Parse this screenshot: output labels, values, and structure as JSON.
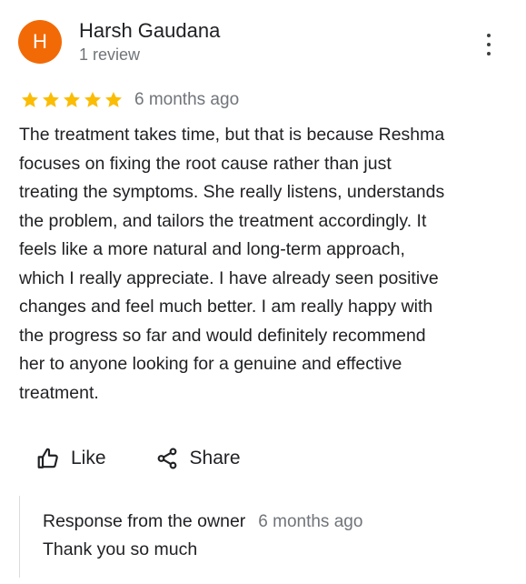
{
  "reviewer": {
    "avatar_initial": "H",
    "avatar_color": "#f26a06",
    "name": "Harsh Gaudana",
    "review_count": "1 review"
  },
  "more_options_icon": "more-vert-icon",
  "rating": {
    "stars": 5,
    "max_stars": 5,
    "star_color": "#fbbc04",
    "time": "6 months ago"
  },
  "review_lines": [
    "The treatment takes time, but that is because Reshma",
    "focuses on fixing the root cause rather than just",
    "treating the symptoms. She really listens, understands",
    "the problem, and tailors the treatment accordingly. It",
    "feels like a more natural and long-term approach,",
    "which I really appreciate. I have already seen positive",
    "changes and feel much better. I am really happy with",
    "the progress so far and would definitely recommend",
    "her to anyone looking for a genuine and effective",
    "treatment."
  ],
  "actions": {
    "like_label": "Like",
    "like_icon": "thumb-up-icon",
    "share_label": "Share",
    "share_icon": "share-icon"
  },
  "owner_response": {
    "title": "Response from the owner",
    "time": "6 months ago",
    "text": "Thank you so much"
  }
}
